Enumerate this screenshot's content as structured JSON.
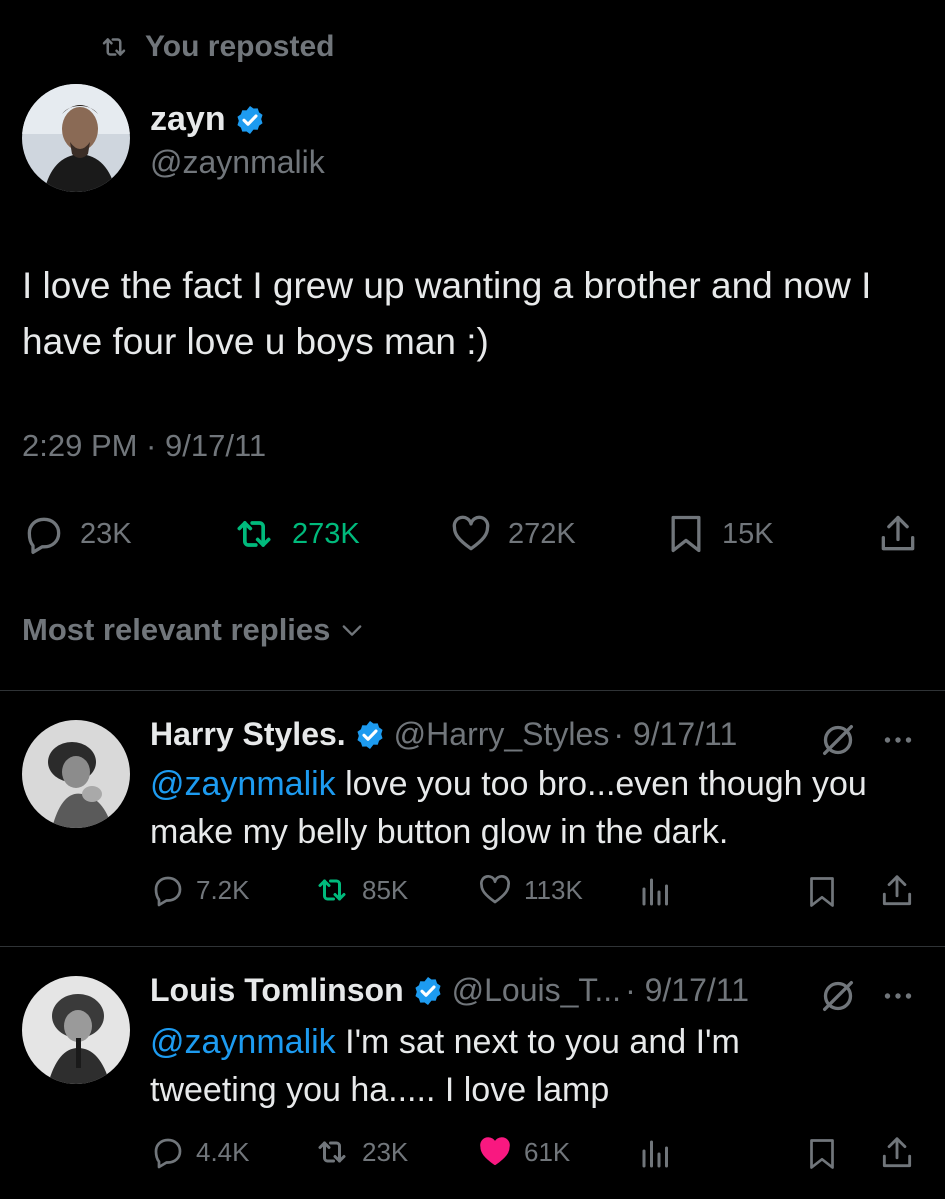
{
  "repost_banner": {
    "label": "You reposted"
  },
  "main_tweet": {
    "display_name": "zayn",
    "handle": "@zaynmalik",
    "text": "I love the fact I grew up wanting a brother and now I have four love u boys man :)",
    "timestamp": "2:29 PM · 9/17/11",
    "stats": {
      "replies": "23K",
      "reposts": "273K",
      "likes": "272K",
      "bookmarks": "15K"
    },
    "reposted_by_you": true
  },
  "replies_sort": {
    "label": "Most relevant replies"
  },
  "replies": [
    {
      "display_name": "Harry Styles.",
      "handle": "@Harry_Styles",
      "date": "· 9/17/11",
      "mention": "@zaynmalik",
      "text": " love you too bro...even though you make my belly button glow in the dark.",
      "stats": {
        "replies": "7.2K",
        "reposts": "85K",
        "likes": "113K"
      },
      "reposted": true,
      "liked": false
    },
    {
      "display_name": "Louis Tomlinson",
      "handle": "@Louis_T...",
      "date": "· 9/17/11",
      "mention": "@zaynmalik",
      "text": " I'm sat next to you and I'm tweeting you ha..... I love lamp",
      "stats": {
        "replies": "4.4K",
        "reposts": "23K",
        "likes": "61K"
      },
      "reposted": false,
      "liked": true
    }
  ],
  "colors": {
    "background": "#000000",
    "text": "#e7e9ea",
    "muted": "#71767b",
    "accent": "#1d9bf0",
    "repost_green": "#00ba7c",
    "like_pink": "#f91880"
  }
}
